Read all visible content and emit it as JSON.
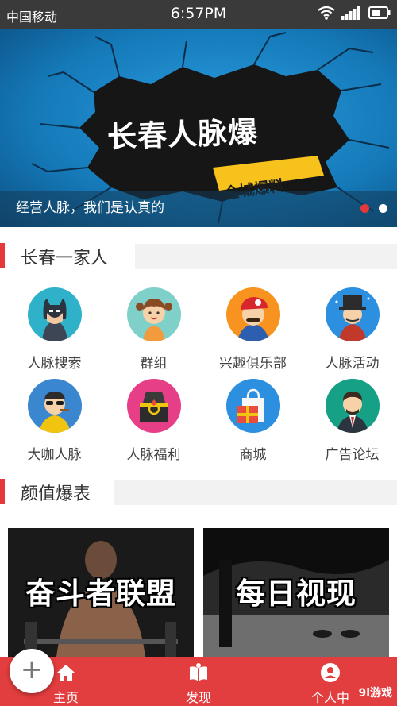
{
  "status_bar": {
    "carrier": "中国移动",
    "time": "6:57PM"
  },
  "banner": {
    "title": "长春人脉爆",
    "subtitle": "全城爆料",
    "caption": "经营人脉，我们是认真的",
    "slide_count": 2,
    "active_slide": 1
  },
  "section1": {
    "title": "长春一家人"
  },
  "grid": {
    "items": [
      {
        "label": "人脉搜索",
        "icon": "batman-avatar-icon",
        "color": "#2fb1c9"
      },
      {
        "label": "群组",
        "icon": "girl-avatar-icon",
        "color": "#7ed0c8"
      },
      {
        "label": "兴趣俱乐部",
        "icon": "mario-avatar-icon",
        "color": "#f7931e"
      },
      {
        "label": "人脉活动",
        "icon": "magician-avatar-icon",
        "color": "#2d8fe0"
      },
      {
        "label": "大咖人脉",
        "icon": "boss-avatar-icon",
        "color": "#3a86cf"
      },
      {
        "label": "人脉福利",
        "icon": "ring-gift-icon",
        "color": "#e63f88"
      },
      {
        "label": "商城",
        "icon": "shopping-bag-icon",
        "color": "#2d8fe0"
      },
      {
        "label": "广告论坛",
        "icon": "businessman-avatar-icon",
        "color": "#16a085"
      }
    ]
  },
  "section2": {
    "title": "颜值爆表"
  },
  "cards": [
    {
      "title": "奋斗者联盟"
    },
    {
      "title": "每日视现"
    }
  ],
  "fab": {
    "symbol": "+"
  },
  "bottom_nav": {
    "items": [
      {
        "label": "主页",
        "icon": "home-icon"
      },
      {
        "label": "发现",
        "icon": "book-icon"
      },
      {
        "label": "个人中",
        "icon": "user-icon"
      }
    ]
  },
  "watermark": "9l游戏",
  "colors": {
    "accent": "#e23d3f",
    "status_bar": "#3a3a3a"
  }
}
